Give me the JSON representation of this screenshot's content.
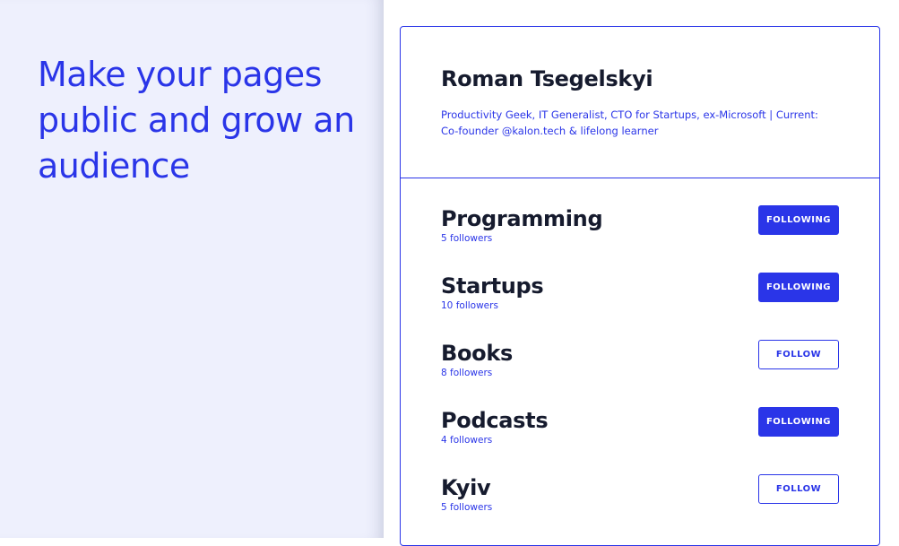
{
  "promo": {
    "headline": "Make your pages public and grow an audience"
  },
  "profile": {
    "name": "Roman Tsegelskyi",
    "bio": "Productivity Geek, IT Generalist, CTO for Startups, ex-Microsoft | Current: Co-founder @kalon.tech & lifelong learner"
  },
  "topics": [
    {
      "title": "Programming",
      "followers": "5 followers",
      "button": "FOLLOWING",
      "following": true
    },
    {
      "title": "Startups",
      "followers": "10 followers",
      "button": "FOLLOWING",
      "following": true
    },
    {
      "title": "Books",
      "followers": "8 followers",
      "button": "FOLLOW",
      "following": false
    },
    {
      "title": "Podcasts",
      "followers": "4 followers",
      "button": "FOLLOWING",
      "following": true
    },
    {
      "title": "Kyiv",
      "followers": "5 followers",
      "button": "FOLLOW",
      "following": false
    }
  ],
  "colors": {
    "accent": "#2a35e8",
    "left_background": "#eef0fd",
    "text_dark": "#161b2e"
  }
}
